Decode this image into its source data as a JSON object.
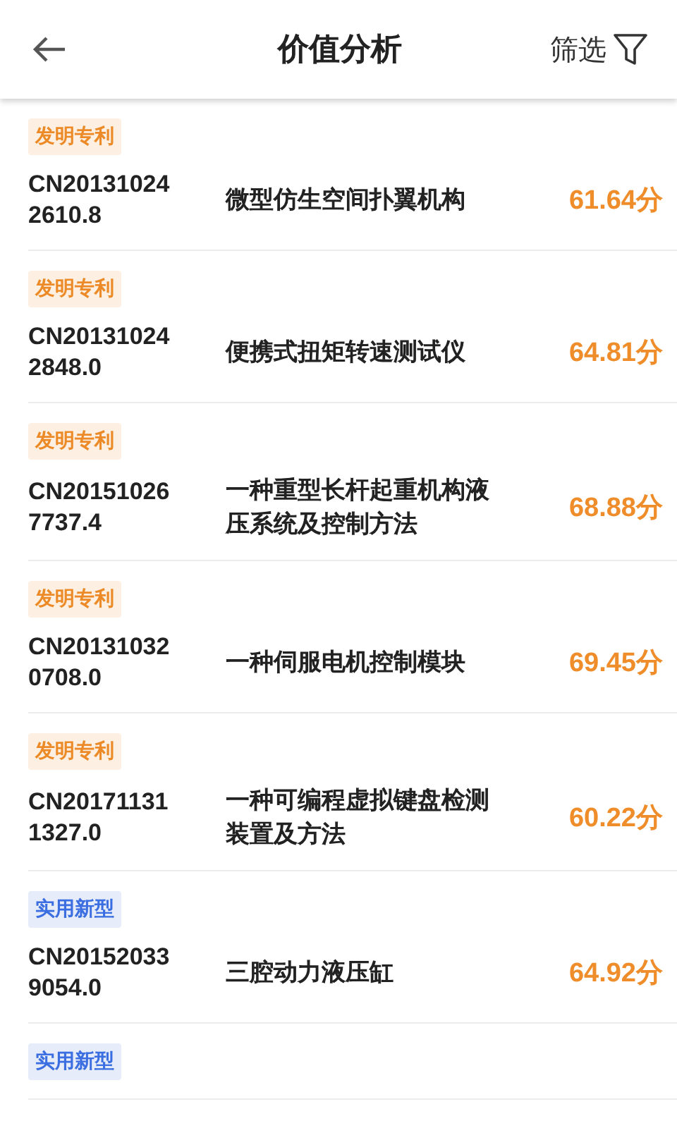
{
  "header": {
    "title": "价值分析",
    "filter": "筛选"
  },
  "patents": [
    {
      "tag": "发明专利",
      "kind": "invention",
      "number": "CN201310242610.8",
      "title": "微型仿生空间扑翼机构",
      "score": "61.64分"
    },
    {
      "tag": "发明专利",
      "kind": "invention",
      "number": "CN201310242848.0",
      "title": "便携式扭矩转速测试仪",
      "score": "64.81分"
    },
    {
      "tag": "发明专利",
      "kind": "invention",
      "number": "CN201510267737.4",
      "title": "一种重型长杆起重机构液压系统及控制方法",
      "score": "68.88分"
    },
    {
      "tag": "发明专利",
      "kind": "invention",
      "number": "CN201310320708.0",
      "title": "一种伺服电机控制模块",
      "score": "69.45分"
    },
    {
      "tag": "发明专利",
      "kind": "invention",
      "number": "CN201711311327.0",
      "title": "一种可编程虚拟键盘检测装置及方法",
      "score": "60.22分"
    },
    {
      "tag": "实用新型",
      "kind": "utility",
      "number": "CN201520339054.0",
      "title": "三腔动力液压缸",
      "score": "64.92分"
    },
    {
      "tag": "实用新型",
      "kind": "utility"
    }
  ]
}
